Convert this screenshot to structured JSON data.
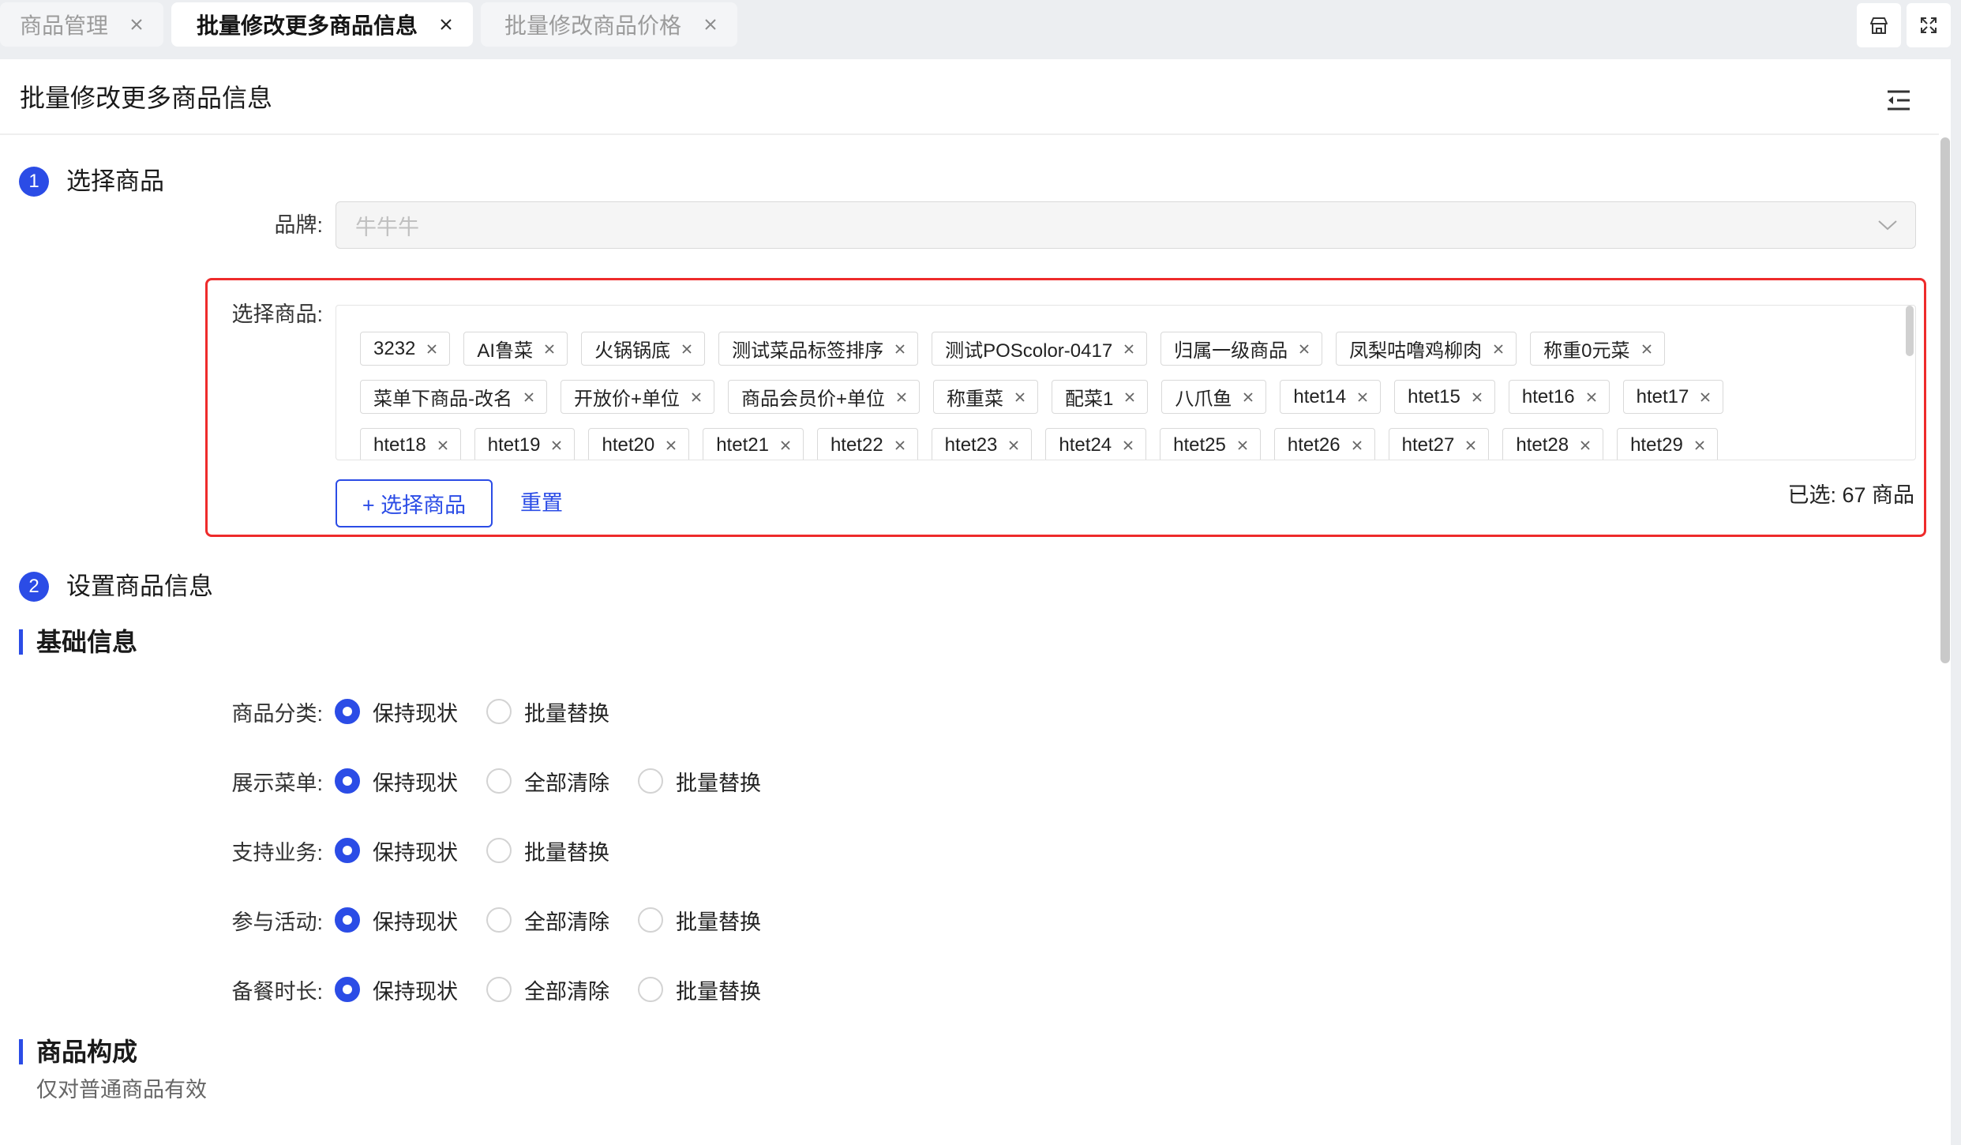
{
  "tabs": [
    {
      "label": "商品管理",
      "active": false
    },
    {
      "label": "批量修改更多商品信息",
      "active": true
    },
    {
      "label": "批量修改商品价格",
      "active": false
    }
  ],
  "toolbar": {
    "icons": [
      "shop-icon",
      "fullscreen-icon"
    ]
  },
  "header": {
    "title": "批量修改更多商品信息",
    "menu_icon": "indent-menu-icon"
  },
  "step1": {
    "number": "1",
    "title": "选择商品",
    "brand": {
      "label": "品牌:",
      "value": "牛牛牛",
      "icon": "chevron-down-icon"
    },
    "products": {
      "label": "选择商品:",
      "tag_rows": [
        [
          "3232",
          "AI鲁菜",
          "火锅锅底",
          "测试菜品标签排序",
          "测试POScolor-0417",
          "归属一级商品",
          "凤梨咕噜鸡柳肉",
          "称重0元菜"
        ],
        [
          "菜单下商品-改名",
          "开放价+单位",
          "商品会员价+单位",
          "称重菜",
          "配菜1",
          "八爪鱼",
          "htet14",
          "htet15",
          "htet16",
          "htet17"
        ],
        [
          "htet18",
          "htet19",
          "htet20",
          "htet21",
          "htet22",
          "htet23",
          "htet24",
          "htet25",
          "htet26",
          "htet27",
          "htet28",
          "htet29"
        ]
      ],
      "select_button": "+ 选择商品",
      "reset_button": "重置",
      "selected_count": "已选: 67 商品"
    }
  },
  "step2": {
    "number": "2",
    "title": "设置商品信息",
    "basic_info": {
      "title": "基础信息",
      "fields": [
        {
          "label": "商品分类:",
          "options": [
            {
              "label": "保持现状",
              "checked": true
            },
            {
              "label": "批量替换",
              "checked": false
            }
          ]
        },
        {
          "label": "展示菜单:",
          "options": [
            {
              "label": "保持现状",
              "checked": true
            },
            {
              "label": "全部清除",
              "checked": false
            },
            {
              "label": "批量替换",
              "checked": false
            }
          ]
        },
        {
          "label": "支持业务:",
          "options": [
            {
              "label": "保持现状",
              "checked": true
            },
            {
              "label": "批量替换",
              "checked": false
            }
          ]
        },
        {
          "label": "参与活动:",
          "options": [
            {
              "label": "保持现状",
              "checked": true
            },
            {
              "label": "全部清除",
              "checked": false
            },
            {
              "label": "批量替换",
              "checked": false
            }
          ]
        },
        {
          "label": "备餐时长:",
          "options": [
            {
              "label": "保持现状",
              "checked": true
            },
            {
              "label": "全部清除",
              "checked": false
            },
            {
              "label": "批量替换",
              "checked": false
            }
          ]
        }
      ]
    },
    "composition": {
      "title": "商品构成",
      "note": "仅对普通商品有效"
    }
  },
  "colors": {
    "accent": "#2b4ce6",
    "highlight_border": "#ee2b2b",
    "page_background": "#eceef1"
  }
}
